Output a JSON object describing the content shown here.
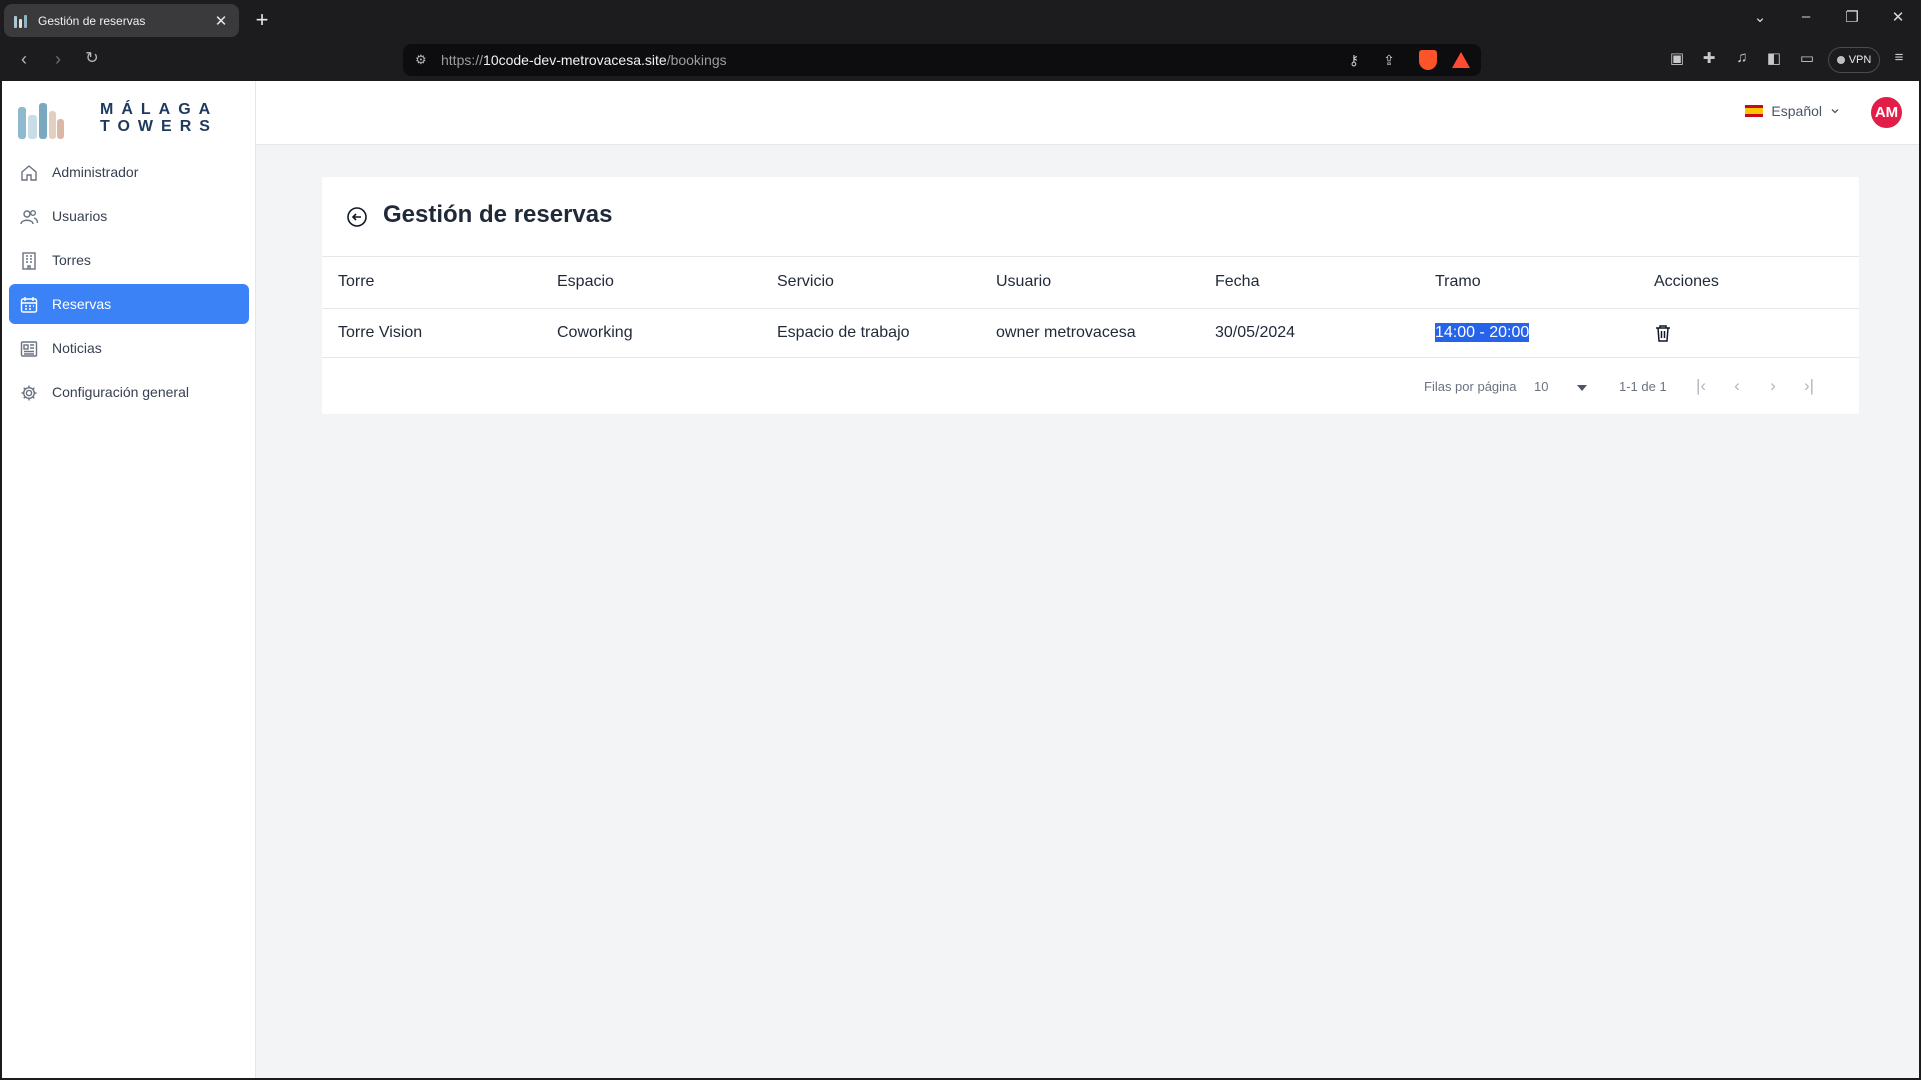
{
  "browser": {
    "tab_title": "Gestión de reservas",
    "tab_close": "✕",
    "new_tab": "+",
    "url_prefix": "https://",
    "url_host": "10code-dev-metrovacesa.site",
    "url_path": "/bookings",
    "vpn_label": "VPN"
  },
  "sidebar": {
    "logo_line1": "MÁLAGA",
    "logo_line2": "TOWERS",
    "items": [
      {
        "label": "Administrador",
        "icon": "home-icon"
      },
      {
        "label": "Usuarios",
        "icon": "users-icon"
      },
      {
        "label": "Torres",
        "icon": "building-icon"
      },
      {
        "label": "Reservas",
        "icon": "calendar-icon",
        "active": true
      },
      {
        "label": "Noticias",
        "icon": "newspaper-icon"
      },
      {
        "label": "Configuración general",
        "icon": "gear-icon"
      }
    ]
  },
  "topbar": {
    "language": "Español",
    "avatar_initials": "AM"
  },
  "page": {
    "title": "Gestión de reservas"
  },
  "table": {
    "headers": [
      "Torre",
      "Espacio",
      "Servicio",
      "Usuario",
      "Fecha",
      "Tramo",
      "Acciones"
    ],
    "rows": [
      [
        "Torre Vision",
        "Coworking",
        "Espacio de trabajo",
        "owner metrovacesa",
        "30/05/2024",
        "14:00 - 20:00"
      ]
    ]
  },
  "pagination": {
    "rows_per_page_label": "Filas por página",
    "rows_per_page": "10",
    "range": "1-1 de 1"
  },
  "colors": {
    "accent": "#3b82f6",
    "avatar": "#e11d48",
    "selection": "#2563eb"
  }
}
